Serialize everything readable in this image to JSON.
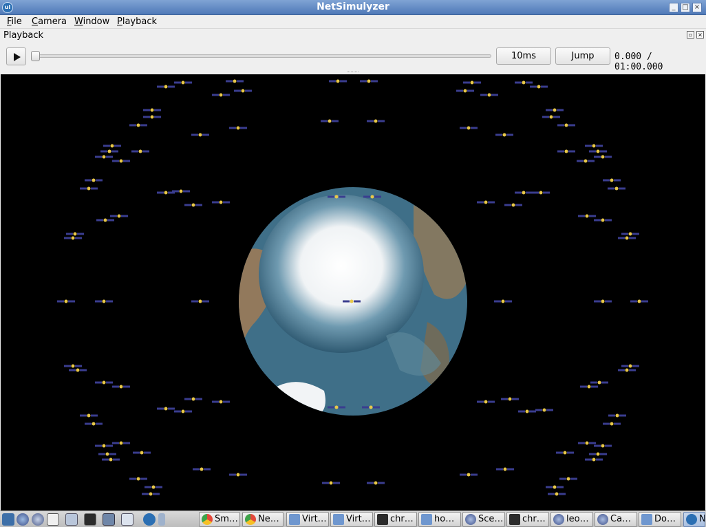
{
  "window": {
    "title": "NetSimulyzer",
    "app_icon": "ul"
  },
  "menu": [
    {
      "key": "file",
      "first": "F",
      "rest": "ile"
    },
    {
      "key": "camera",
      "first": "C",
      "rest": "amera"
    },
    {
      "key": "window",
      "first": "W",
      "rest": "indow"
    },
    {
      "key": "playback",
      "first": "P",
      "rest": "layback"
    }
  ],
  "playback": {
    "title": "Playback",
    "step_label": "10ms",
    "jump_label": "Jump",
    "time_readout": "0.000 / 01:00.000",
    "progress": 0.0
  },
  "scene": {
    "background": "#000000",
    "earth_colors": {
      "ice": "#f4f6f8",
      "ocean": "#3f6f88",
      "land": "#9b7a58",
      "shade": "#4c6a74"
    },
    "satellite_colors": {
      "panel": "#3a3d8f",
      "body": "#e8c84a"
    }
  },
  "taskbar": {
    "tasks": [
      {
        "label": "Sm…",
        "icon": "chrome-icon",
        "color": "#e3483a"
      },
      {
        "label": "Ne…",
        "icon": "chrome-icon",
        "color": "#e3483a"
      },
      {
        "label": "Virt…",
        "icon": "folder-icon",
        "color": "#6f97cf"
      },
      {
        "label": "Virt…",
        "icon": "folder-icon",
        "color": "#6f97cf"
      },
      {
        "label": "chr…",
        "icon": "terminal-icon",
        "color": "#2b2b2b"
      },
      {
        "label": "ho…",
        "icon": "folder-icon",
        "color": "#6f97cf"
      },
      {
        "label": "Sce…",
        "icon": "globe-icon",
        "color": "#3d4f8a"
      },
      {
        "label": "chr…",
        "icon": "terminal-icon",
        "color": "#2b2b2b"
      },
      {
        "label": "leo…",
        "icon": "globe-icon",
        "color": "#3d4f8a"
      },
      {
        "label": "Ca…",
        "icon": "globe-icon",
        "color": "#3d4f8a"
      },
      {
        "label": "Do…",
        "icon": "folder-icon",
        "color": "#6f97cf"
      },
      {
        "label": "N",
        "icon": "netsimulyzer-icon",
        "color": "#2b6fb3"
      }
    ]
  }
}
